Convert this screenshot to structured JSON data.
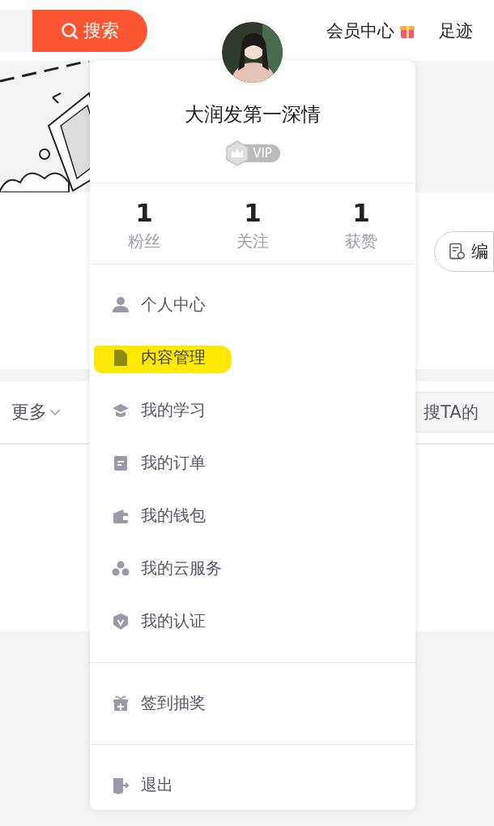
{
  "header": {
    "search_button": "搜索",
    "links": [
      {
        "label": "会员中心",
        "kind": "gift"
      },
      {
        "label": "足迹",
        "kind": "plain"
      }
    ]
  },
  "profile": {
    "edit_button": "编"
  },
  "toolbar": {
    "more": "更多",
    "search_placeholder": "搜TA的"
  },
  "menu": {
    "username": "大润发第一深情",
    "badge": "VIP",
    "stats": [
      {
        "value": "1",
        "label": "粉丝"
      },
      {
        "value": "1",
        "label": "关注"
      },
      {
        "value": "1",
        "label": "获赞"
      }
    ],
    "groups": [
      [
        {
          "label": "个人中心",
          "kind": "user",
          "highlighted": false
        },
        {
          "label": "内容管理",
          "kind": "doc",
          "highlighted": true
        },
        {
          "label": "我的学习",
          "kind": "cap",
          "highlighted": false
        },
        {
          "label": "我的订单",
          "kind": "order",
          "highlighted": false
        },
        {
          "label": "我的钱包",
          "kind": "wallet",
          "highlighted": false
        },
        {
          "label": "我的云服务",
          "kind": "cloud",
          "highlighted": false
        },
        {
          "label": "我的认证",
          "kind": "shield",
          "highlighted": false
        }
      ],
      [
        {
          "label": "签到抽奖",
          "kind": "gift",
          "highlighted": false
        }
      ],
      [
        {
          "label": "退出",
          "kind": "exit",
          "highlighted": false
        }
      ]
    ]
  }
}
